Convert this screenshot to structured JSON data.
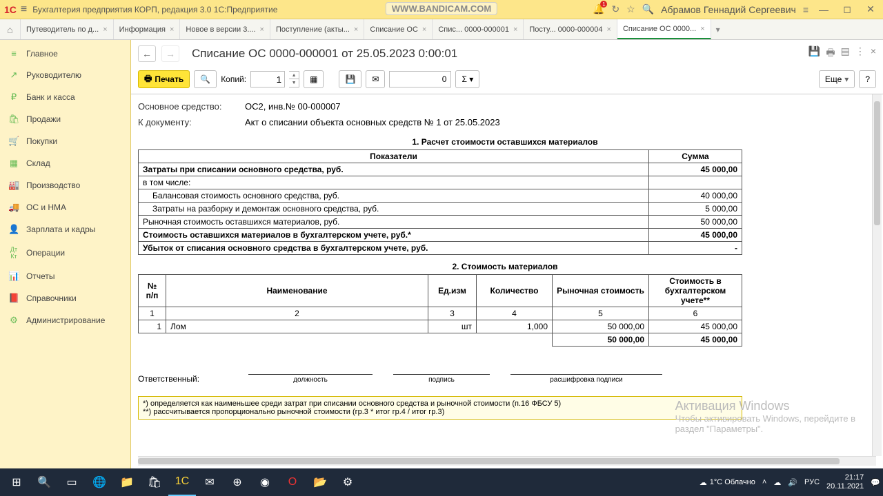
{
  "titlebar": {
    "app_title": "Бухгалтерия предприятия КОРП, редакция 3.0 1С:Предприятие",
    "watermark": "WWW.BANDICAM.COM",
    "user": "Абрамов Геннадий Сергеевич",
    "notif_count": "1"
  },
  "tabs": [
    {
      "label": "Путеводитель по д..."
    },
    {
      "label": "Информация"
    },
    {
      "label": "Новое в версии 3...."
    },
    {
      "label": "Поступление (акты..."
    },
    {
      "label": "Списание ОС"
    },
    {
      "label": "Спис... 0000-000001"
    },
    {
      "label": "Посту... 0000-000004"
    },
    {
      "label": "Списание ОС 0000..."
    }
  ],
  "sidebar": [
    {
      "icon": "≡",
      "label": "Главное"
    },
    {
      "icon": "↗",
      "label": "Руководителю"
    },
    {
      "icon": "₽",
      "label": "Банк и касса"
    },
    {
      "icon": "🛍",
      "label": "Продажи"
    },
    {
      "icon": "🛒",
      "label": "Покупки"
    },
    {
      "icon": "▦",
      "label": "Склад"
    },
    {
      "icon": "🏭",
      "label": "Производство"
    },
    {
      "icon": "🚚",
      "label": "ОС и НМА"
    },
    {
      "icon": "👤",
      "label": "Зарплата и кадры"
    },
    {
      "icon": "ᴬᴷ",
      "label": "Операции"
    },
    {
      "icon": "📊",
      "label": "Отчеты"
    },
    {
      "icon": "📕",
      "label": "Справочники"
    },
    {
      "icon": "⚙",
      "label": "Администрирование"
    }
  ],
  "doc": {
    "title": "Списание ОС 0000-000001 от 25.05.2023 0:00:01",
    "print_btn": "Печать",
    "copies_label": "Копий:",
    "copies_value": "1",
    "sum_value": "0",
    "more_btn": "Еще",
    "help_btn": "?",
    "fields": {
      "os_label": "Основное средство:",
      "os_value": "ОС2, инв.№ 00-000007",
      "doc_label": "К документу:",
      "doc_value": "Акт о списании объекта основных средств № 1 от 25.05.2023"
    },
    "section1": "1. Расчет стоимости оставшихся материалов",
    "section2": "2. Стоимость материалов",
    "t1_headers": {
      "c1": "Показатели",
      "c2": "Сумма"
    },
    "t1_rows": [
      {
        "label": "Затраты при списании основного средства, руб.",
        "val": "45 000,00",
        "bold": true
      },
      {
        "label": "в том числе:",
        "val": ""
      },
      {
        "label": "Балансовая стоимость основного средства, руб.",
        "val": "40 000,00",
        "indent": 2
      },
      {
        "label": "Затраты на разборку и демонтаж основного средства, руб.",
        "val": "5 000,00",
        "indent": 2
      },
      {
        "label": "Рыночная стоимость оставшихся материалов, руб.",
        "val": "50 000,00"
      },
      {
        "label": "Стоимость оставшихся материалов в бухгалтерском учете, руб.*",
        "val": "45 000,00",
        "bold": true
      },
      {
        "label": "Убыток от списания основного средства в бухгалтерском учете, руб.",
        "val": "-",
        "bold": true
      }
    ],
    "t2_headers": [
      "№ п/п",
      "Наименование",
      "Ед.изм",
      "Количество",
      "Рыночная стоимость",
      "Стоимость в бухгалтерском учете**"
    ],
    "t2_colnums": [
      "1",
      "2",
      "3",
      "4",
      "5",
      "6"
    ],
    "t2_row": {
      "n": "1",
      "name": "Лом",
      "unit": "шт",
      "qty": "1,000",
      "market": "50 000,00",
      "book": "45 000,00"
    },
    "t2_totals": {
      "market": "50 000,00",
      "book": "45 000,00"
    },
    "responsible": "Ответственный:",
    "sign_cols": [
      "должность",
      "подпись",
      "расшифровка подписи"
    ],
    "footnote1": "*) определяется как наименьшее среди затрат при списании основного средства и рыночной стоимости (п.16 ФБСУ 5)",
    "footnote2": "**) рассчитывается пропорционально рыночной стоимости (гр.3 * итог гр.4 / итог гр.3)"
  },
  "win_activate": {
    "l1": "Активация Windows",
    "l2": "Чтобы активировать Windows, перейдите в",
    "l3": "раздел \"Параметры\"."
  },
  "taskbar": {
    "weather": "1°C Облачно",
    "lang": "РУС",
    "time": "21:17",
    "date": "20.11.2021"
  }
}
